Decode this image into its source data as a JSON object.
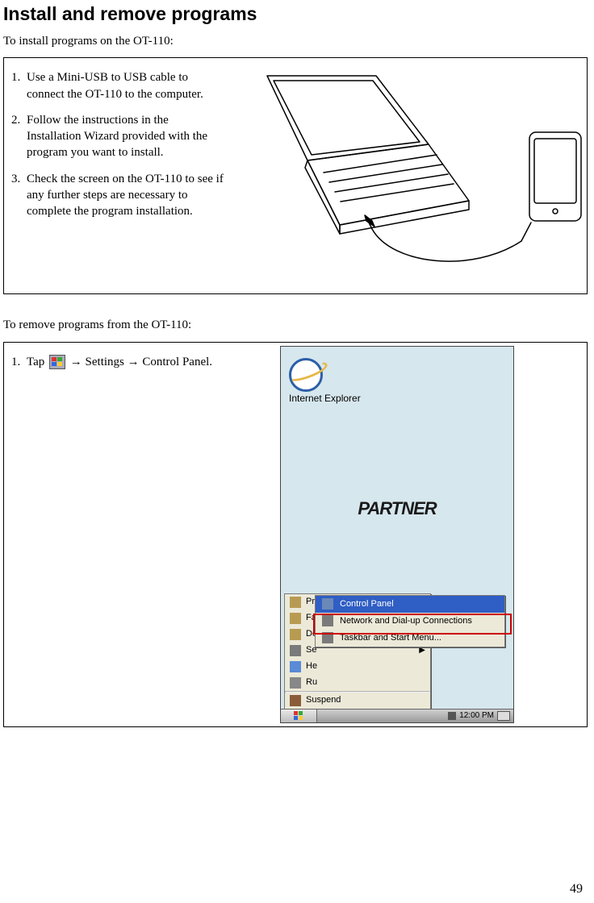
{
  "title": "Install and remove programs",
  "intro_install": "To install programs on the OT-110:",
  "install_steps": [
    "Use a Mini-USB to USB  cable to connect the OT-110 to the computer.",
    "Follow the instructions in the Installation Wizard provided with the program you want to install.",
    "Check the screen on the OT-110 to see if any further steps are necessary to complete the program installation."
  ],
  "intro_remove": "To remove programs from the OT-110:",
  "remove_step_prefix": "Tap",
  "remove_step_suffix": " → Settings → Control Panel.",
  "screenshot": {
    "desktop_icon_label": "Internet Explorer",
    "partner_logo": "PARTNER",
    "start_menu": [
      {
        "icon": "programs-icon",
        "label": "Programs",
        "submenu": true
      },
      {
        "icon": "favorites-icon",
        "label": "Favorites",
        "submenu": true
      },
      {
        "icon": "documents-icon",
        "label": "Documents",
        "submenu": true
      },
      {
        "icon": "settings-icon",
        "label": "Settings",
        "submenu": true,
        "short": "Se"
      },
      {
        "icon": "help-icon",
        "label": "Help",
        "submenu": false,
        "short": "He"
      },
      {
        "icon": "run-icon",
        "label": "Run...",
        "submenu": false,
        "short": "Ru"
      }
    ],
    "start_menu_bottom": {
      "icon": "suspend-icon",
      "label": "Suspend"
    },
    "settings_submenu": [
      {
        "icon": "control-panel-icon",
        "label": "Control Panel",
        "highlight": true
      },
      {
        "icon": "network-icon",
        "label": "Network and Dial-up Connections",
        "highlight": false
      },
      {
        "icon": "taskbar-icon",
        "label": "Taskbar and Start Menu...",
        "highlight": false
      }
    ],
    "clock": "12:00 PM"
  },
  "page_number": "49"
}
